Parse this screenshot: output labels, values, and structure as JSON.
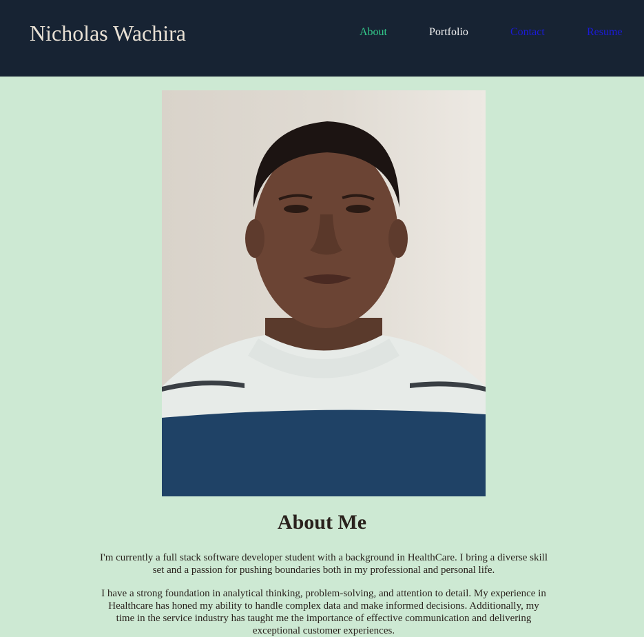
{
  "header": {
    "site_title": "Nicholas Wachira",
    "nav": [
      {
        "label": "About"
      },
      {
        "label": "Portfolio"
      },
      {
        "label": "Contact"
      },
      {
        "label": "Resume"
      }
    ]
  },
  "about": {
    "heading": "About Me",
    "paragraphs": [
      "I'm currently a full stack software developer student with a background in HealthCare. I bring a diverse skill set and a passion for pushing boundaries both in my professional and personal life.",
      "I have a strong foundation in analytical thinking, problem-solving, and attention to detail. My experience in Healthcare has honed my ability to handle complex data and make informed decisions. Additionally, my time in the service industry has taught me the importance of effective communication and delivering exceptional customer experiences."
    ]
  },
  "colors": {
    "header_bg": "#172333",
    "page_bg": "#cde9d3",
    "nav_active": "#33c98b",
    "nav_link": "#1b1bd8"
  },
  "photo": {
    "icon": "profile-photo"
  }
}
